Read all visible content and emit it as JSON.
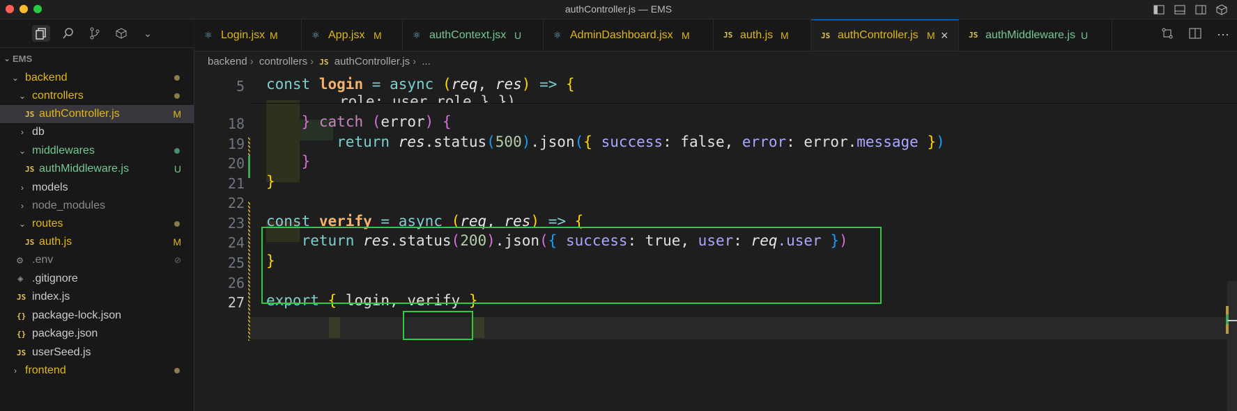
{
  "window": {
    "title": "authController.js — EMS"
  },
  "sidebar": {
    "root": "EMS",
    "items": [
      {
        "label": "backend",
        "kind": "folder",
        "open": true,
        "color": "#e2b714",
        "status": "dot",
        "dot_color": "#8b7a4a"
      },
      {
        "label": "controllers",
        "kind": "folder",
        "open": true,
        "color": "#e2b714",
        "status": "dot",
        "dot_color": "#8b7a4a"
      },
      {
        "label": "authController.js",
        "kind": "js",
        "color": "#e2b714",
        "status": "M"
      },
      {
        "label": "db",
        "kind": "folder",
        "open": false,
        "color": "#cccccc"
      },
      {
        "label": "middlewares",
        "kind": "folder",
        "open": true,
        "color": "#73c991",
        "status": "dot",
        "dot_color": "#4b8a6a"
      },
      {
        "label": "authMiddleware.js",
        "kind": "js",
        "color": "#73c991",
        "status": "U"
      },
      {
        "label": "models",
        "kind": "folder",
        "open": false,
        "color": "#cccccc"
      },
      {
        "label": "node_modules",
        "kind": "folder",
        "open": false,
        "color": "#8a8a8a"
      },
      {
        "label": "routes",
        "kind": "folder",
        "open": true,
        "color": "#e2b714",
        "status": "dot",
        "dot_color": "#8b7a4a"
      },
      {
        "label": "auth.js",
        "kind": "js",
        "color": "#e2b714",
        "status": "M"
      },
      {
        "label": ".env",
        "kind": "gear",
        "color": "#8a8a8a",
        "status": "ignored"
      },
      {
        "label": ".gitignore",
        "kind": "git",
        "color": "#cccccc"
      },
      {
        "label": "index.js",
        "kind": "js",
        "color": "#cccccc"
      },
      {
        "label": "package-lock.json",
        "kind": "json",
        "color": "#cccccc"
      },
      {
        "label": "package.json",
        "kind": "json",
        "color": "#cccccc"
      },
      {
        "label": "userSeed.js",
        "kind": "js",
        "color": "#cccccc"
      },
      {
        "label": "frontend",
        "kind": "folder",
        "open": false,
        "color": "#e2b714",
        "status": "dot",
        "dot_color": "#8b7a4a"
      }
    ]
  },
  "tabs": [
    {
      "label": "Login.jsx",
      "badge": "M",
      "icon": "react-icon",
      "color": "#e2b714"
    },
    {
      "label": "App.jsx",
      "badge": "M",
      "icon": "react-icon",
      "color": "#e2b714"
    },
    {
      "label": "authContext.jsx",
      "badge": "U",
      "icon": "react-icon",
      "color": "#73c991"
    },
    {
      "label": "AdminDashboard.jsx",
      "badge": "M",
      "icon": "react-icon",
      "color": "#e2b714"
    },
    {
      "label": "auth.js",
      "badge": "M",
      "icon": "js-icon",
      "color": "#e2b714"
    },
    {
      "label": "authController.js",
      "badge": "M",
      "icon": "js-icon",
      "color": "#e2b714",
      "active": true
    },
    {
      "label": "authMiddleware.js",
      "badge": "U",
      "icon": "js-icon",
      "color": "#73c991"
    }
  ],
  "breadcrumb": [
    "backend",
    "controllers",
    "authController.js",
    "..."
  ],
  "editor": {
    "line_numbers": [
      "5",
      "18",
      "19",
      "20",
      "21",
      "22",
      "23",
      "24",
      "25",
      "26",
      "27"
    ],
    "sticky_tail": "role: user.role } })",
    "code": {
      "l5": [
        "const",
        "login",
        "=",
        "async",
        "(",
        "req",
        ", ",
        "res",
        ")",
        "=>",
        "{"
      ],
      "l18": [
        "}",
        "catch",
        "(",
        "error",
        ")",
        "{"
      ],
      "l19": [
        "return",
        "res",
        ".status",
        "(",
        "500",
        ")",
        ".json",
        "(",
        "{",
        "success",
        ": ",
        "false",
        ", ",
        "error",
        ": ",
        "error.",
        "message",
        "}",
        ")"
      ],
      "l20": [
        "}"
      ],
      "l21": [
        "}"
      ],
      "l23": [
        "const",
        "verify",
        "=",
        "async",
        "(",
        "req",
        ", ",
        "res",
        ")",
        "=>",
        "{"
      ],
      "l24": [
        "return",
        "res",
        ".status",
        "(",
        "200",
        ")",
        ".json",
        "(",
        "{",
        "success",
        ": ",
        "true",
        ", ",
        "user",
        ": ",
        "req",
        ".user",
        "}",
        ")"
      ],
      "l25": [
        "}"
      ],
      "l27": [
        "export",
        "{",
        "login,",
        "verify",
        "}"
      ]
    }
  }
}
